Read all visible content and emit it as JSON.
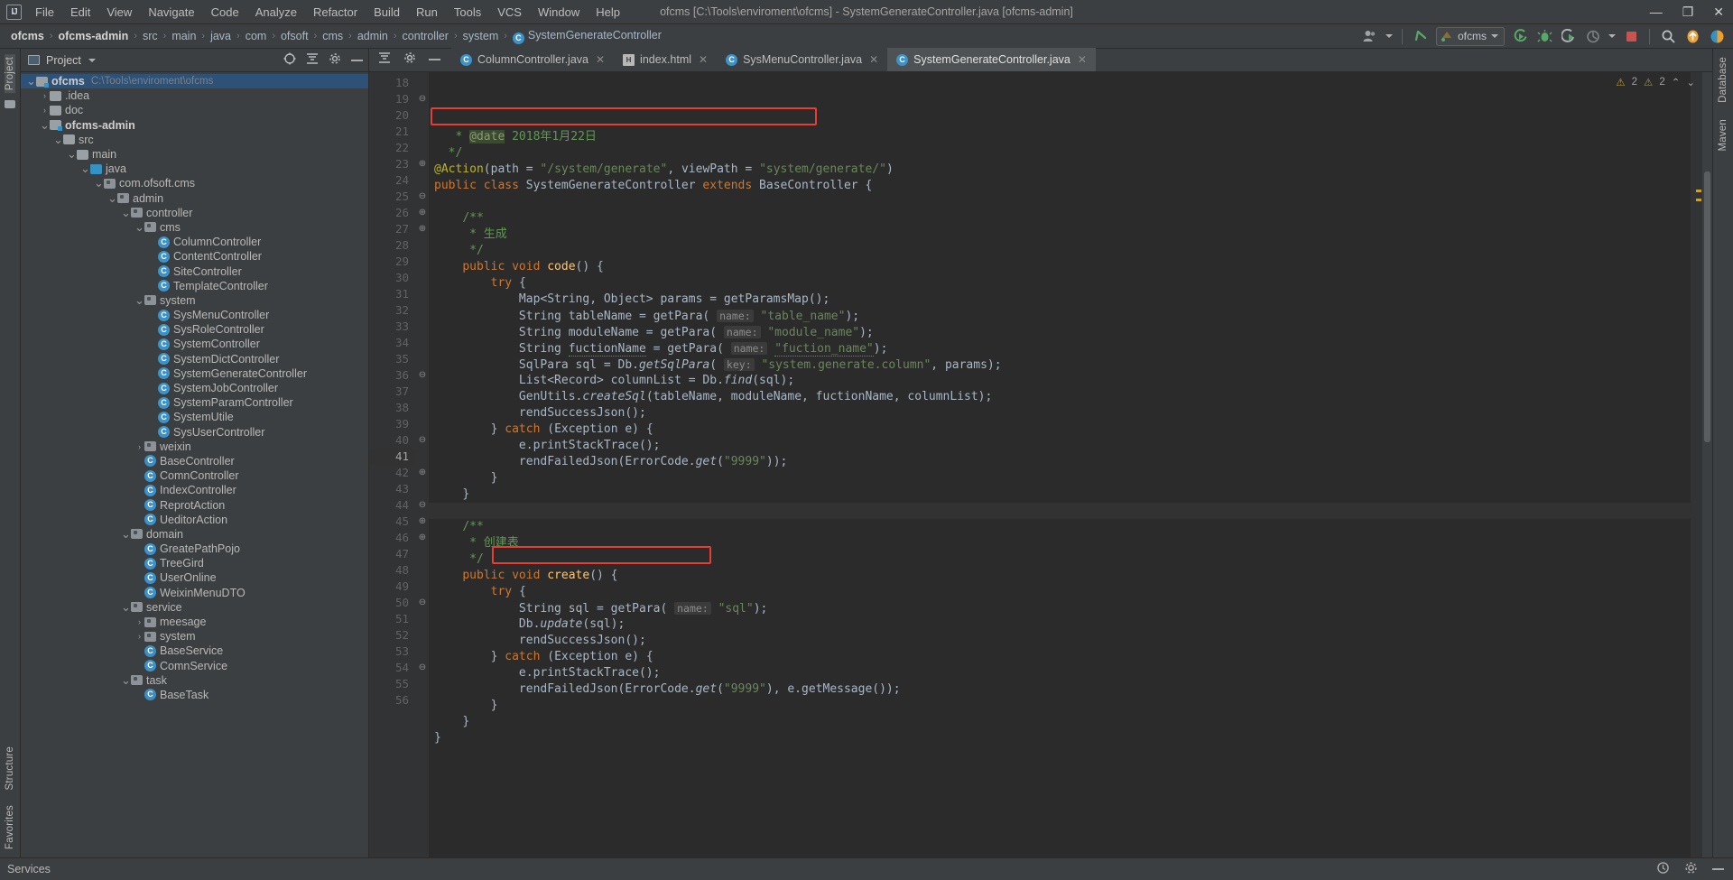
{
  "window": {
    "title": "ofcms [C:\\Tools\\enviroment\\ofcms] - SystemGenerateController.java [ofcms-admin]",
    "minimize": "—",
    "maximize": "❐",
    "close": "✕"
  },
  "menu": [
    "File",
    "Edit",
    "View",
    "Navigate",
    "Code",
    "Analyze",
    "Refactor",
    "Build",
    "Run",
    "Tools",
    "VCS",
    "Window",
    "Help"
  ],
  "breadcrumb": [
    {
      "label": "ofcms",
      "bold": true
    },
    {
      "label": "ofcms-admin",
      "bold": true
    },
    {
      "label": "src",
      "bold": false
    },
    {
      "label": "main",
      "bold": false
    },
    {
      "label": "java",
      "bold": false
    },
    {
      "label": "com",
      "bold": false
    },
    {
      "label": "ofsoft",
      "bold": false
    },
    {
      "label": "cms",
      "bold": false
    },
    {
      "label": "admin",
      "bold": false
    },
    {
      "label": "controller",
      "bold": false
    },
    {
      "label": "system",
      "bold": false
    },
    {
      "label": "SystemGenerateController",
      "bold": false,
      "icon": "class-icon"
    }
  ],
  "toolbar": {
    "avatar_icon": "user-avatar-icon",
    "vcs_update_icon": "vcs-update-arrow-icon",
    "run_config": "ofcms",
    "run_icon": "run-icon",
    "debug_icon": "debug-bug-icon",
    "run_coverage_icon": "run-with-coverage-icon",
    "profile_icon": "profiler-icon",
    "stop_icon": "stop-icon",
    "search_icon": "search-everywhere-icon",
    "updates_icon": "update-available-icon",
    "feature_icon": "feature-trainer-icon"
  },
  "left_rail": {
    "project_label": "Project",
    "structure_label": "Structure",
    "favorites_label": "Favorites"
  },
  "right_rail": {
    "database_label": "Database",
    "maven_label": "Maven"
  },
  "project_panel": {
    "title": "Project",
    "collapse_all_icon": "collapse-all-icon",
    "locate_icon": "select-opened-file-icon",
    "settings_icon": "gear-icon",
    "hide_icon": "hide-icon",
    "tree": [
      {
        "depth": 0,
        "arrow": "v",
        "icon": "folder-module",
        "label": "ofcms",
        "bold": true,
        "path": "C:\\Tools\\enviroment\\ofcms",
        "selected": true
      },
      {
        "depth": 1,
        "arrow": ">",
        "icon": "folder",
        "label": ".idea",
        "bold": false
      },
      {
        "depth": 1,
        "arrow": ">",
        "icon": "folder",
        "label": "doc",
        "bold": false
      },
      {
        "depth": 1,
        "arrow": "v",
        "icon": "folder-module",
        "label": "ofcms-admin",
        "bold": true
      },
      {
        "depth": 2,
        "arrow": "v",
        "icon": "folder",
        "label": "src",
        "bold": false
      },
      {
        "depth": 3,
        "arrow": "v",
        "icon": "folder",
        "label": "main",
        "bold": false
      },
      {
        "depth": 4,
        "arrow": "v",
        "icon": "folder-source",
        "label": "java",
        "bold": false
      },
      {
        "depth": 5,
        "arrow": "v",
        "icon": "folder-package",
        "label": "com.ofsoft.cms",
        "bold": false
      },
      {
        "depth": 6,
        "arrow": "v",
        "icon": "folder-package",
        "label": "admin",
        "bold": false
      },
      {
        "depth": 7,
        "arrow": "v",
        "icon": "folder-package",
        "label": "controller",
        "bold": false
      },
      {
        "depth": 8,
        "arrow": "v",
        "icon": "folder-package",
        "label": "cms",
        "bold": false
      },
      {
        "depth": 9,
        "arrow": "",
        "icon": "class",
        "label": "ColumnController",
        "bold": false
      },
      {
        "depth": 9,
        "arrow": "",
        "icon": "class",
        "label": "ContentController",
        "bold": false
      },
      {
        "depth": 9,
        "arrow": "",
        "icon": "class",
        "label": "SiteController",
        "bold": false
      },
      {
        "depth": 9,
        "arrow": "",
        "icon": "class",
        "label": "TemplateController",
        "bold": false
      },
      {
        "depth": 8,
        "arrow": "v",
        "icon": "folder-package",
        "label": "system",
        "bold": false
      },
      {
        "depth": 9,
        "arrow": "",
        "icon": "class",
        "label": "SysMenuController",
        "bold": false
      },
      {
        "depth": 9,
        "arrow": "",
        "icon": "class",
        "label": "SysRoleController",
        "bold": false
      },
      {
        "depth": 9,
        "arrow": "",
        "icon": "class",
        "label": "SystemController",
        "bold": false
      },
      {
        "depth": 9,
        "arrow": "",
        "icon": "class",
        "label": "SystemDictController",
        "bold": false
      },
      {
        "depth": 9,
        "arrow": "",
        "icon": "class",
        "label": "SystemGenerateController",
        "bold": false
      },
      {
        "depth": 9,
        "arrow": "",
        "icon": "class",
        "label": "SystemJobController",
        "bold": false
      },
      {
        "depth": 9,
        "arrow": "",
        "icon": "class",
        "label": "SystemParamController",
        "bold": false
      },
      {
        "depth": 9,
        "arrow": "",
        "icon": "class",
        "label": "SystemUtile",
        "bold": false
      },
      {
        "depth": 9,
        "arrow": "",
        "icon": "class",
        "label": "SysUserController",
        "bold": false
      },
      {
        "depth": 8,
        "arrow": ">",
        "icon": "folder-package",
        "label": "weixin",
        "bold": false
      },
      {
        "depth": 8,
        "arrow": "",
        "icon": "class-abstract",
        "label": "BaseController",
        "bold": false
      },
      {
        "depth": 8,
        "arrow": "",
        "icon": "class",
        "label": "ComnController",
        "bold": false
      },
      {
        "depth": 8,
        "arrow": "",
        "icon": "class",
        "label": "IndexController",
        "bold": false
      },
      {
        "depth": 8,
        "arrow": "",
        "icon": "class",
        "label": "ReprotAction",
        "bold": false
      },
      {
        "depth": 8,
        "arrow": "",
        "icon": "class",
        "label": "UeditorAction",
        "bold": false
      },
      {
        "depth": 7,
        "arrow": "v",
        "icon": "folder-package",
        "label": "domain",
        "bold": false
      },
      {
        "depth": 8,
        "arrow": "",
        "icon": "class",
        "label": "GreatePathPojo",
        "bold": false
      },
      {
        "depth": 8,
        "arrow": "",
        "icon": "class",
        "label": "TreeGird",
        "bold": false
      },
      {
        "depth": 8,
        "arrow": "",
        "icon": "class",
        "label": "UserOnline",
        "bold": false
      },
      {
        "depth": 8,
        "arrow": "",
        "icon": "class",
        "label": "WeixinMenuDTO",
        "bold": false
      },
      {
        "depth": 7,
        "arrow": "v",
        "icon": "folder-package",
        "label": "service",
        "bold": false
      },
      {
        "depth": 8,
        "arrow": ">",
        "icon": "folder-package",
        "label": "meesage",
        "bold": false
      },
      {
        "depth": 8,
        "arrow": ">",
        "icon": "folder-package",
        "label": "system",
        "bold": false
      },
      {
        "depth": 8,
        "arrow": "",
        "icon": "class-abstract",
        "label": "BaseService",
        "bold": false
      },
      {
        "depth": 8,
        "arrow": "",
        "icon": "class",
        "label": "ComnService",
        "bold": false
      },
      {
        "depth": 7,
        "arrow": "v",
        "icon": "folder-package",
        "label": "task",
        "bold": false
      },
      {
        "depth": 8,
        "arrow": "",
        "icon": "class-abstract",
        "label": "BaseTask",
        "bold": false
      }
    ]
  },
  "tabs": [
    {
      "label": "ColumnController.java",
      "icon": "java-class-icon",
      "active": false
    },
    {
      "label": "index.html",
      "icon": "html-file-icon",
      "active": false
    },
    {
      "label": "SysMenuController.java",
      "icon": "java-class-icon",
      "active": false
    },
    {
      "label": "SystemGenerateController.java",
      "icon": "java-class-icon",
      "active": true
    }
  ],
  "inspections": {
    "warnings_count": "2",
    "weak_warnings_count": "2",
    "warning_icon": "warning-triangle-icon",
    "weak_icon": "weak-warning-icon",
    "up_icon": "prev-highlight-icon",
    "down_icon": "next-highlight-icon"
  },
  "editor": {
    "current_line": 41,
    "first_line": 18,
    "last_line": 56,
    "highlight_boxes": [
      {
        "line": 20,
        "note": "@Action annotation line"
      },
      {
        "line": 47,
        "note": "String sql = getPara(name: \"sql\");"
      }
    ],
    "lines": [
      {
        "n": 18,
        "fold": "",
        "html": "   <span class=\"cmt\">* </span><span class=\"cmt-tag\">@date</span><span class=\"cmt\"> 2018年1月22日</span>"
      },
      {
        "n": 19,
        "fold": "⊖",
        "html": "  <span class=\"cmt\">*/</span>"
      },
      {
        "n": 20,
        "fold": "",
        "html": "<span class=\"anno\">@Action</span><span class=\"id\">(</span><span class=\"id\">path = </span><span class=\"str\">\"/system/generate\"</span><span class=\"id\">, viewPath = </span><span class=\"str\">\"system/generate/\"</span><span class=\"id\">)</span>"
      },
      {
        "n": 21,
        "fold": "",
        "html": "<span class=\"kw\">public class </span><span class=\"id\">SystemGenerateController </span><span class=\"kw\">extends </span><span class=\"id\">BaseController {</span>"
      },
      {
        "n": 22,
        "fold": "",
        "html": ""
      },
      {
        "n": 23,
        "fold": "⊕",
        "html": "    <span class=\"cmt\">/**</span>"
      },
      {
        "n": 24,
        "fold": "",
        "html": "     <span class=\"cmt\">* 生成</span>"
      },
      {
        "n": 25,
        "fold": "⊖",
        "html": "     <span class=\"cmt\">*/</span>"
      },
      {
        "n": 26,
        "fold": "⊕",
        "html": "    <span class=\"kw\">public void </span><span class=\"fn\">code</span><span class=\"id\">() {</span>"
      },
      {
        "n": 27,
        "fold": "⊕",
        "html": "        <span class=\"kw\">try </span><span class=\"id\">{</span>"
      },
      {
        "n": 28,
        "fold": "",
        "html": "            <span class=\"id\">Map&lt;String, Object&gt; params = getParamsMap();</span>"
      },
      {
        "n": 29,
        "fold": "",
        "html": "            <span class=\"id\">String tableName = getPara(</span> <span class=\"hint\">name:</span> <span class=\"str\">\"table_name\"</span><span class=\"id\">);</span>"
      },
      {
        "n": 30,
        "fold": "",
        "html": "            <span class=\"id\">String moduleName = getPara(</span> <span class=\"hint\">name:</span> <span class=\"str\">\"module_name\"</span><span class=\"id\">);</span>"
      },
      {
        "n": 31,
        "fold": "",
        "html": "            <span class=\"id\">String <span class=\"warnu\">fuctionName</span> = getPara(</span> <span class=\"hint\">name:</span> <span class=\"str warnu\">\"fuction_name\"</span><span class=\"id\">);</span>"
      },
      {
        "n": 32,
        "fold": "",
        "html": "            <span class=\"id\">SqlPara sql = Db.</span><span class=\"itl\">getSqlPara</span><span class=\"id\">(</span> <span class=\"hint\">key:</span> <span class=\"str\">\"system.generate.column\"</span><span class=\"id\">, params);</span>"
      },
      {
        "n": 33,
        "fold": "",
        "html": "            <span class=\"id\">List&lt;Record&gt; columnList = Db.</span><span class=\"itl\">find</span><span class=\"id\">(sql);</span>"
      },
      {
        "n": 34,
        "fold": "",
        "html": "            <span class=\"id\">GenUtils.</span><span class=\"itl\">createSql</span><span class=\"id\">(tableName, moduleName, fuctionName, columnList);</span>"
      },
      {
        "n": 35,
        "fold": "",
        "html": "            <span class=\"id\">rendSuccessJson();</span>"
      },
      {
        "n": 36,
        "fold": "⊖",
        "html": "        <span class=\"id\">} </span><span class=\"kw\">catch </span><span class=\"id\">(Exception e) {</span>"
      },
      {
        "n": 37,
        "fold": "",
        "html": "            <span class=\"id\">e.printStackTrace();</span>"
      },
      {
        "n": 38,
        "fold": "",
        "html": "            <span class=\"id\">rendFailedJson(ErrorCode.</span><span class=\"itl\">get</span><span class=\"id\">(</span><span class=\"str\">\"9999\"</span><span class=\"id\">));</span>"
      },
      {
        "n": 39,
        "fold": "",
        "html": "        <span class=\"id\">}</span>"
      },
      {
        "n": 40,
        "fold": "⊖",
        "html": "    <span class=\"id\">}</span>"
      },
      {
        "n": 41,
        "fold": "",
        "html": ""
      },
      {
        "n": 42,
        "fold": "⊕",
        "html": "    <span class=\"cmt\">/**</span>"
      },
      {
        "n": 43,
        "fold": "",
        "html": "     <span class=\"cmt\">* 创建表</span>"
      },
      {
        "n": 44,
        "fold": "⊖",
        "html": "     <span class=\"cmt\">*/</span>"
      },
      {
        "n": 45,
        "fold": "⊕",
        "html": "    <span class=\"kw\">public void </span><span class=\"fn\">create</span><span class=\"id\">() {</span>"
      },
      {
        "n": 46,
        "fold": "⊕",
        "html": "        <span class=\"kw\">try </span><span class=\"id\">{</span>"
      },
      {
        "n": 47,
        "fold": "",
        "html": "            <span class=\"id\">String sql = getPara(</span> <span class=\"hint\">name:</span> <span class=\"str\">\"sql\"</span><span class=\"id\">);</span>"
      },
      {
        "n": 48,
        "fold": "",
        "html": "            <span class=\"id\">Db.</span><span class=\"itl\">update</span><span class=\"id\">(sql);</span>"
      },
      {
        "n": 49,
        "fold": "",
        "html": "            <span class=\"id\">rendSuccessJson();</span>"
      },
      {
        "n": 50,
        "fold": "⊖",
        "html": "        <span class=\"id\">} </span><span class=\"kw\">catch </span><span class=\"id\">(Exception e) {</span>"
      },
      {
        "n": 51,
        "fold": "",
        "html": "            <span class=\"id\">e.printStackTrace();</span>"
      },
      {
        "n": 52,
        "fold": "",
        "html": "            <span class=\"id\">rendFailedJson(ErrorCode.</span><span class=\"itl\">get</span><span class=\"id\">(</span><span class=\"str\">\"9999\"</span><span class=\"id\">), e.getMessage());</span>"
      },
      {
        "n": 53,
        "fold": "",
        "html": "        <span class=\"id\">}</span>"
      },
      {
        "n": 54,
        "fold": "⊖",
        "html": "    <span class=\"id\">}</span>"
      },
      {
        "n": 55,
        "fold": "",
        "html": "<span class=\"id\">}</span>"
      },
      {
        "n": 56,
        "fold": "",
        "html": ""
      }
    ]
  },
  "status_bar": {
    "services_label": "Services",
    "event_log_icon": "event-log-icon",
    "settings_icon": "settings-gear-icon",
    "hide_icon": "hide-window-icon"
  }
}
